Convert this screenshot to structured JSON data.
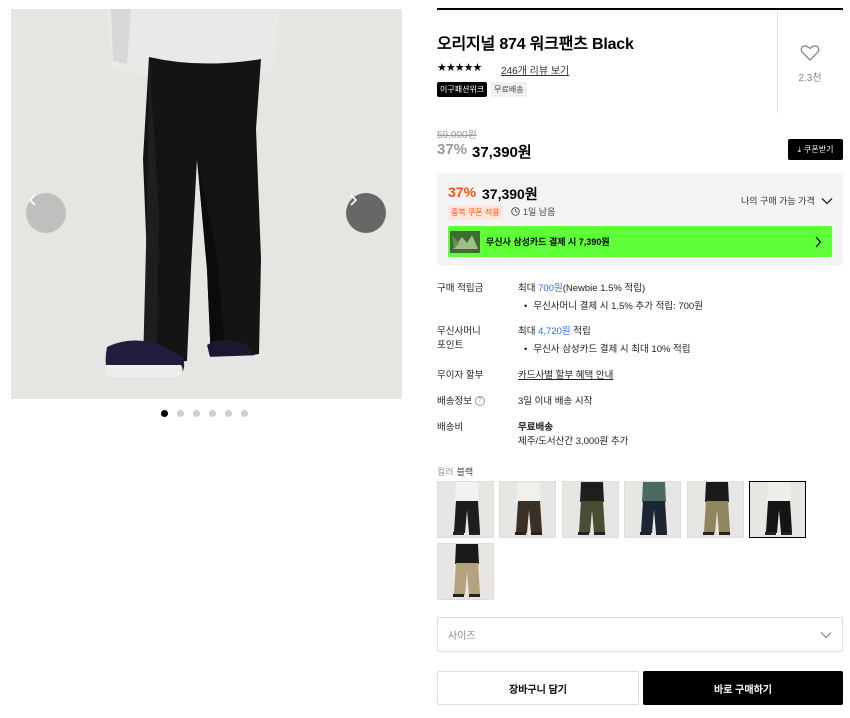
{
  "product": {
    "title": "오리지널 874 워크팬츠 Black",
    "rating_stars": "★★★★★",
    "review_link": "246개 리뷰 보기",
    "badges": [
      "이구패션위크",
      "무료배송"
    ],
    "like_count": "2.3천"
  },
  "gallery": {
    "image_count": 6,
    "active_index": 0
  },
  "price": {
    "original": "59,000원",
    "discount": "37%",
    "sale": "37,390원",
    "coupon_button": "쿠폰받기"
  },
  "my_price": {
    "discount": "37%",
    "price": "37,390원",
    "coupon_tag": "중복 쿠폰 적용",
    "time_left": "1일 남음",
    "toggle_label": "나의 구매 가능 가격",
    "card_banner": "무신사 삼성카드 결제 시 7,390원"
  },
  "info": {
    "points": {
      "label": "구매 적립금",
      "prefix": "최대 ",
      "amount": "700원",
      "suffix": "(Newbie 1.5% 적립)",
      "sub": "무신사머니 결제 시 1.5% 추가 적립: 700원"
    },
    "money_points": {
      "label_line1": "무신사머니",
      "label_line2": "포인트",
      "prefix": "최대 ",
      "amount": "4,720원",
      "suffix": " 적립",
      "sub": "무신사 삼성카드 결제 시 최대 10% 적립"
    },
    "installment": {
      "label": "무이자 할부",
      "value": "카드사별 할부 혜택 안내"
    },
    "shipping": {
      "label": "배송정보",
      "help": "?",
      "value": "3일 이내 배송 시작"
    },
    "shipping_fee": {
      "label": "배송비",
      "value": "무료배송",
      "sub": "제주/도서산간 3,000원 추가"
    }
  },
  "options": {
    "color_label": "컬러",
    "color_value": "블랙",
    "swatches": [
      {
        "name": "white-top-black-pants",
        "top": "#f2f2f0",
        "pants": "#1d1d1d"
      },
      {
        "name": "black-top-brown-pants",
        "top": "#f0efec",
        "pants": "#3a3026"
      },
      {
        "name": "olive",
        "top": "#1e1e1e",
        "pants": "#4a4d33"
      },
      {
        "name": "navy",
        "top": "#4c6b5e",
        "pants": "#1c2533"
      },
      {
        "name": "khaki",
        "top": "#1a1a1a",
        "pants": "#8f865f"
      },
      {
        "name": "black",
        "top": "#efeeea",
        "pants": "#151515",
        "selected": true
      },
      {
        "name": "beige",
        "top": "#1a1a1a",
        "pants": "#b4a27d"
      }
    ],
    "size_placeholder": "사이즈"
  },
  "actions": {
    "cart": "장바구니 담기",
    "buy": "바로 구매하기"
  }
}
